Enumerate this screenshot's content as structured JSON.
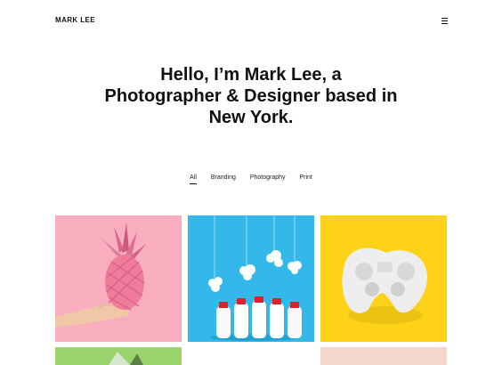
{
  "header": {
    "brand": "MARK LEE",
    "menu_icon": "hamburger-menu-icon"
  },
  "hero": {
    "line1": "Hello, I’m Mark Lee, a",
    "line2": "Photographer & Designer based in",
    "line3": "New York."
  },
  "filters": {
    "tabs": [
      "All",
      "Branding",
      "Photography",
      "Print"
    ],
    "active": "All"
  },
  "portfolio": {
    "items": [
      {
        "subject": "pink pineapple held in hand",
        "bg_color": "#f8aebf"
      },
      {
        "subject": "white bottles with red caps and hanging clouds",
        "bg_color": "#34b8ea"
      },
      {
        "subject": "white game controller",
        "bg_color": "#ffd21a"
      },
      {
        "subject": "green partial tile",
        "bg_color": "#9ad46c"
      },
      {
        "subject": "peach partial tile",
        "bg_color": "#f4d6cb"
      }
    ]
  }
}
